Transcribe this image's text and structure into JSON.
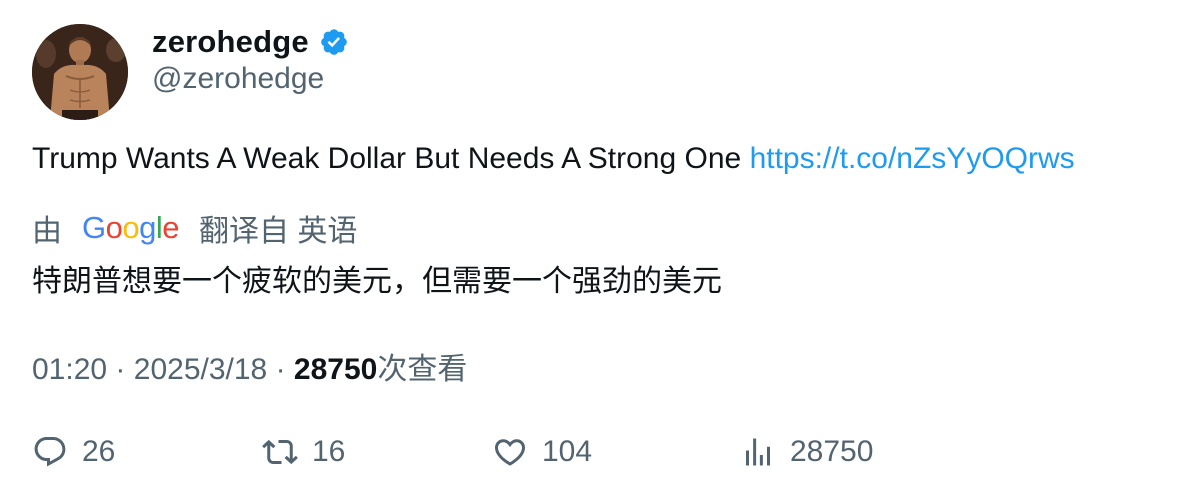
{
  "author": {
    "display_name": "zerohedge",
    "handle": "@zerohedge",
    "verified": true,
    "verified_color": "#1d9bf0"
  },
  "tweet": {
    "text": "Trump Wants A Weak Dollar But Needs A Strong One",
    "link": "https://t.co/nZsYyOQrws"
  },
  "translation": {
    "prefix": "由",
    "provider_letters": [
      "G",
      "o",
      "o",
      "g",
      "l",
      "e"
    ],
    "suffix": "翻译自 英语",
    "text": "特朗普想要一个疲软的美元，但需要一个强劲的美元"
  },
  "meta": {
    "time": "01:20",
    "separator": "·",
    "date": "2025/3/18",
    "views": "28750",
    "views_label": "次查看"
  },
  "actions": {
    "reply": {
      "icon": "reply-icon",
      "count": "26"
    },
    "retweet": {
      "icon": "retweet-icon",
      "count": "16"
    },
    "like": {
      "icon": "heart-icon",
      "count": "104"
    },
    "views": {
      "icon": "analytics-icon",
      "count": "28750"
    }
  },
  "colors": {
    "text": "#0f1419",
    "secondary": "#536471",
    "link": "#1d9bf0"
  }
}
